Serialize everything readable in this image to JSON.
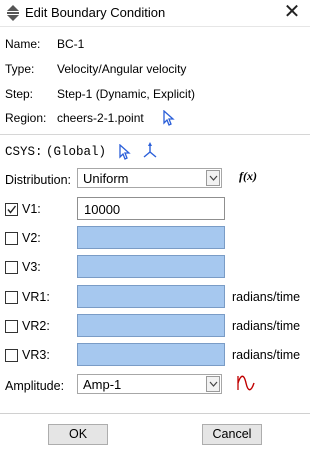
{
  "window": {
    "title": "Edit Boundary Condition",
    "close_symbol": "✕"
  },
  "info": {
    "name_label": "Name:",
    "name_value": "BC-1",
    "type_label": "Type:",
    "type_value": "Velocity/Angular velocity",
    "step_label": "Step:",
    "step_value": "Step-1 (Dynamic, Explicit)",
    "region_label": "Region:",
    "region_value": "cheers-2-1.point"
  },
  "csys": {
    "label": "CSYS:",
    "value": "(Global)"
  },
  "distribution": {
    "label": "Distribution:",
    "selected": "Uniform",
    "fx_label": "f(x)"
  },
  "components": [
    {
      "label": "V1:",
      "checked": true,
      "value": "10000",
      "unit": ""
    },
    {
      "label": "V2:",
      "checked": false,
      "value": "",
      "unit": ""
    },
    {
      "label": "V3:",
      "checked": false,
      "value": "",
      "unit": ""
    },
    {
      "label": "VR1:",
      "checked": false,
      "value": "",
      "unit": "radians/time"
    },
    {
      "label": "VR2:",
      "checked": false,
      "value": "",
      "unit": "radians/time"
    },
    {
      "label": "VR3:",
      "checked": false,
      "value": "",
      "unit": "radians/time"
    }
  ],
  "amplitude": {
    "label": "Amplitude:",
    "selected": "Amp-1"
  },
  "buttons": {
    "ok": "OK",
    "cancel": "Cancel"
  },
  "colors": {
    "disabled_field": "#a6c8ef",
    "pick_arrow": "#2b5fd9",
    "amplitude_icon": "#c00000"
  }
}
